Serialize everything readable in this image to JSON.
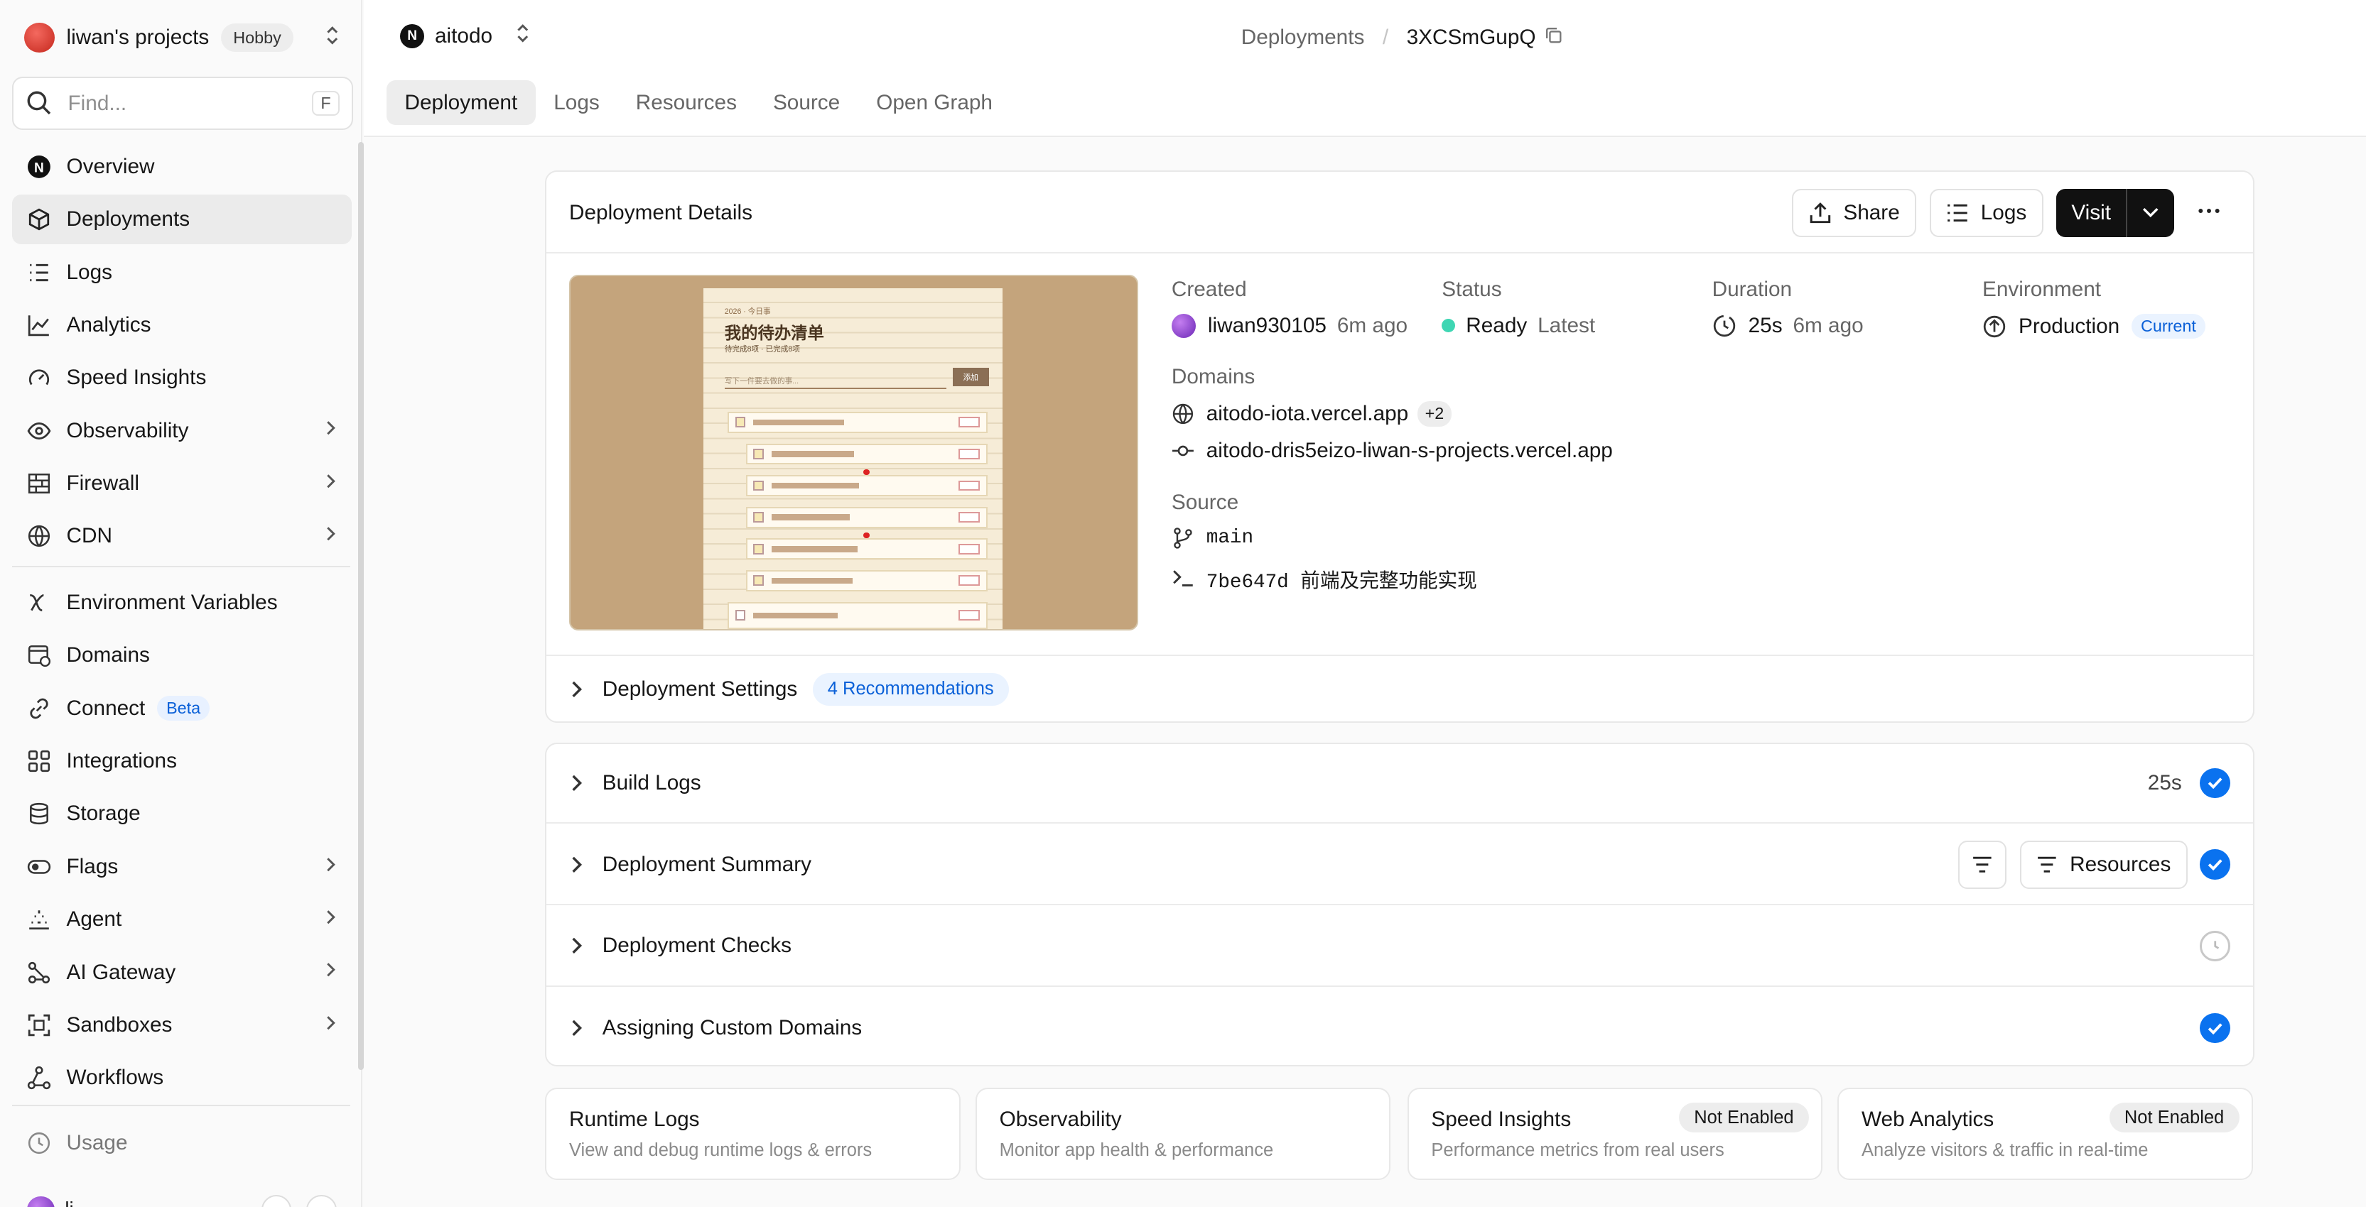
{
  "sidebar": {
    "team_name": "liwan's projects",
    "plan_badge": "Hobby",
    "search_placeholder": "Find...",
    "search_shortcut": "F",
    "items": [
      {
        "label": "Overview"
      },
      {
        "label": "Deployments"
      },
      {
        "label": "Logs"
      },
      {
        "label": "Analytics"
      },
      {
        "label": "Speed Insights"
      },
      {
        "label": "Observability"
      },
      {
        "label": "Firewall"
      },
      {
        "label": "CDN"
      },
      {
        "label": "Environment Variables"
      },
      {
        "label": "Domains"
      },
      {
        "label": "Connect",
        "badge": "Beta"
      },
      {
        "label": "Integrations"
      },
      {
        "label": "Storage"
      },
      {
        "label": "Flags"
      },
      {
        "label": "Agent"
      },
      {
        "label": "AI Gateway"
      },
      {
        "label": "Sandboxes"
      },
      {
        "label": "Workflows"
      },
      {
        "label": "Usage"
      }
    ],
    "user_initial": "li"
  },
  "header": {
    "project": "aitodo",
    "project_logo": "N",
    "breadcrumb": {
      "parent": "Deployments",
      "current": "3XCSmGupQ"
    },
    "tabs": [
      "Deployment",
      "Logs",
      "Resources",
      "Source",
      "Open Graph"
    ]
  },
  "details": {
    "title": "Deployment Details",
    "share": "Share",
    "logs": "Logs",
    "visit": "Visit",
    "created_label": "Created",
    "created_user": "liwan930105",
    "created_time": "6m ago",
    "status_label": "Status",
    "status_value": "Ready",
    "status_note": "Latest",
    "duration_label": "Duration",
    "duration_value": "25s",
    "duration_time": "6m ago",
    "environment_label": "Environment",
    "environment_value": "Production",
    "environment_badge": "Current",
    "domains_label": "Domains",
    "domain_primary": "aitodo-iota.vercel.app",
    "domain_more": "+2",
    "domain_branch": "aitodo-dris5eizo-liwan-s-projects.vercel.app",
    "source_label": "Source",
    "branch": "main",
    "commit": "7be647d 前端及完整功能实现",
    "settings": "Deployment Settings",
    "recommendations": "4 Recommendations"
  },
  "preview": {
    "heading": "我的待办清单",
    "subheading": "待完成8项 · 已完成8项",
    "date_tag": "2026 · 今日事",
    "input_placeholder": "写下一件要去做的事...",
    "add_button": "添加"
  },
  "accordion": {
    "build_logs": "Build Logs",
    "build_time": "25s",
    "summary": "Deployment Summary",
    "resources": "Resources",
    "checks": "Deployment Checks",
    "domains": "Assigning Custom Domains"
  },
  "cards": [
    {
      "title": "Runtime Logs",
      "desc": "View and debug runtime logs & errors"
    },
    {
      "title": "Observability",
      "desc": "Monitor app health & performance"
    },
    {
      "title": "Speed Insights",
      "desc": "Performance metrics from real users",
      "badge": "Not Enabled"
    },
    {
      "title": "Web Analytics",
      "desc": "Analyze visitors & traffic in real-time",
      "badge": "Not Enabled"
    }
  ],
  "colors": {
    "accent": "#0a72ef",
    "ready": "#3fd6b3",
    "team": "#d9352a"
  }
}
